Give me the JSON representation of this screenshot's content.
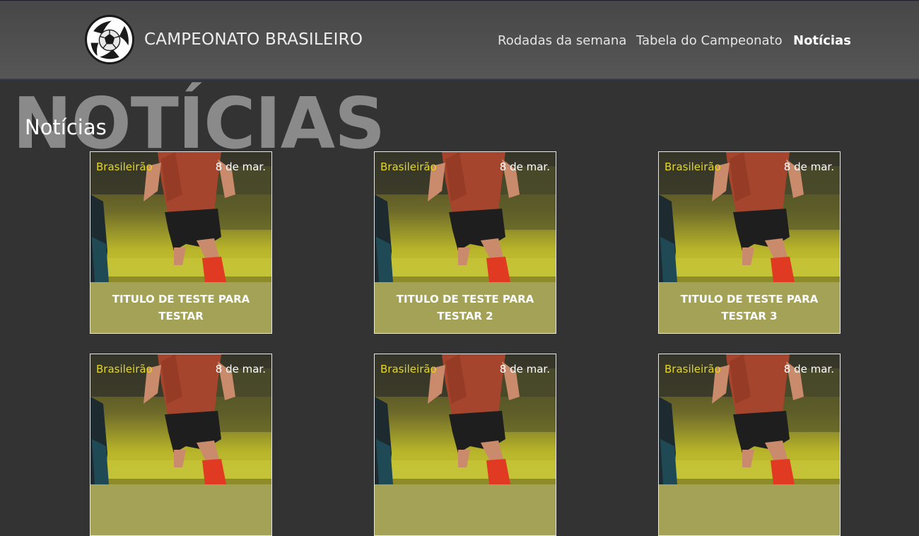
{
  "header": {
    "brand": "CAMPEONATO BRASILEIRO",
    "logo_icon": "soccer-ball-icon",
    "nav": [
      {
        "label": "Rodadas da semana",
        "active": false
      },
      {
        "label": "Tabela do Campeonato",
        "active": false
      },
      {
        "label": "Notícias",
        "active": true
      }
    ]
  },
  "page": {
    "background_title": "NOTÍCIAS",
    "title": "Notícias"
  },
  "cards": [
    {
      "category": "Brasileirão",
      "date": "8 de mar.",
      "title": "TITULO DE TESTE PARA TESTAR"
    },
    {
      "category": "Brasileirão",
      "date": "8 de mar.",
      "title": "TITULO DE TESTE PARA TESTAR 2"
    },
    {
      "category": "Brasileirão",
      "date": "8 de mar.",
      "title": "TITULO DE TESTE PARA TESTAR 3"
    },
    {
      "category": "Brasileirão",
      "date": "8 de mar.",
      "title": ""
    },
    {
      "category": "Brasileirão",
      "date": "8 de mar.",
      "title": ""
    },
    {
      "category": "Brasileirão",
      "date": "8 de mar.",
      "title": ""
    }
  ],
  "colors": {
    "background": "#333333",
    "header": "#505050",
    "category": "#e3d91f",
    "caption": "#a3a257"
  }
}
